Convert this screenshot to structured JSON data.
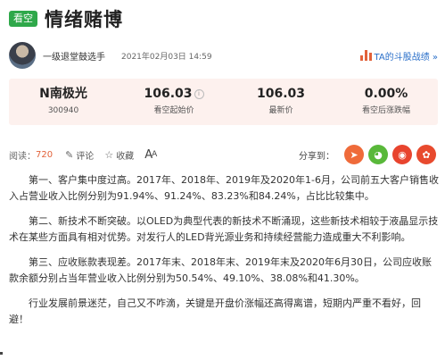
{
  "header": {
    "tag": "看空",
    "title": "情绪赌博"
  },
  "author": {
    "name": "一级退堂鼓选手",
    "date": "2021年02月03日 14:59",
    "ta_link": "TA的斗股战绩 »"
  },
  "stock": {
    "name": "N南极光",
    "code": "300940",
    "start_price": "106.03",
    "start_price_label": "看空起始价",
    "latest_price": "106.03",
    "latest_price_label": "最新价",
    "change": "0.00%",
    "change_label": "看空后涨跌幅"
  },
  "actions": {
    "read_label": "阅读：",
    "read_count": "720",
    "comment_label": "评论",
    "favorite_label": "收藏",
    "font_label": "A",
    "font_small": "A",
    "share_label": "分享到："
  },
  "share_buttons": [
    {
      "name": "share-telegram-icon",
      "glyph": "➤",
      "color": "#ef6b3a"
    },
    {
      "name": "share-wechat-icon",
      "glyph": "◕",
      "color": "#59b83a"
    },
    {
      "name": "share-weibo-icon",
      "glyph": "◉",
      "color": "#e8442e"
    },
    {
      "name": "share-qq-icon",
      "glyph": "✿",
      "color": "#e84a2e"
    }
  ],
  "article": {
    "p1": "第一、客户集中度过高。2017年、2018年、2019年及2020年1-6月，公司前五大客户销售收入占营业收入比例分别为91.94%、91.24%、83.23%和84.24%，占比比较集中。",
    "p2": "第二、新技术不断突破。以OLED为典型代表的新技术不断涌现，这些新技术相较于液晶显示技术在某些方面具有相对优势。对发行人的LED背光源业务和持续经营能力造成重大不利影响。",
    "p3": "第三、应收账款表现差。2017年末、2018年末、2019年末及2020年6月30日，公司应收账款余额分别占当年营业收入比例分别为50.54%、49.10%、38.08%和41.30%。",
    "p4": "行业发展前景迷茫，自己又不咋滴，关键是开盘价涨幅还高得离谱，短期内严重不看好，回避！"
  }
}
